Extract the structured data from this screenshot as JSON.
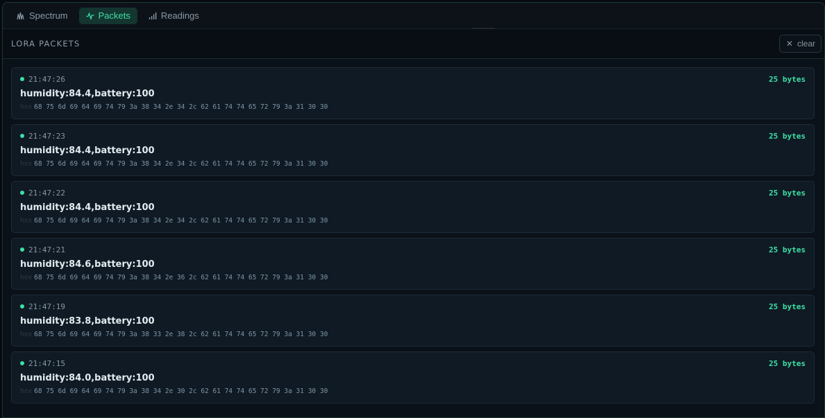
{
  "tabs": [
    {
      "label": "Spectrum",
      "icon": "spectrum-icon",
      "active": false
    },
    {
      "label": "Packets",
      "icon": "pulse-icon",
      "active": true
    },
    {
      "label": "Readings",
      "icon": "bar-signal-icon",
      "active": false
    }
  ],
  "header": {
    "title": "LORA PACKETS",
    "clear_label": "clear"
  },
  "hex_label": "hex",
  "packets": [
    {
      "time": "21:47:26",
      "size": "25 bytes",
      "payload": "humidity:84.4,battery:100",
      "hex": "68 75 6d 69 64 69 74 79 3a 38 34 2e 34 2c 62 61 74 74 65 72 79 3a 31 30 30"
    },
    {
      "time": "21:47:23",
      "size": "25 bytes",
      "payload": "humidity:84.4,battery:100",
      "hex": "68 75 6d 69 64 69 74 79 3a 38 34 2e 34 2c 62 61 74 74 65 72 79 3a 31 30 30"
    },
    {
      "time": "21:47:22",
      "size": "25 bytes",
      "payload": "humidity:84.4,battery:100",
      "hex": "68 75 6d 69 64 69 74 79 3a 38 34 2e 34 2c 62 61 74 74 65 72 79 3a 31 30 30"
    },
    {
      "time": "21:47:21",
      "size": "25 bytes",
      "payload": "humidity:84.6,battery:100",
      "hex": "68 75 6d 69 64 69 74 79 3a 38 34 2e 36 2c 62 61 74 74 65 72 79 3a 31 30 30"
    },
    {
      "time": "21:47:19",
      "size": "25 bytes",
      "payload": "humidity:83.8,battery:100",
      "hex": "68 75 6d 69 64 69 74 79 3a 38 33 2e 38 2c 62 61 74 74 65 72 79 3a 31 30 30"
    },
    {
      "time": "21:47:15",
      "size": "25 bytes",
      "payload": "humidity:84.0,battery:100",
      "hex": "68 75 6d 69 64 69 74 79 3a 38 34 2e 30 2c 62 61 74 74 65 72 79 3a 31 30 30"
    }
  ],
  "colors": {
    "accent": "#3ee0a6",
    "background": "#0b1118",
    "card": "#0f1a24"
  }
}
